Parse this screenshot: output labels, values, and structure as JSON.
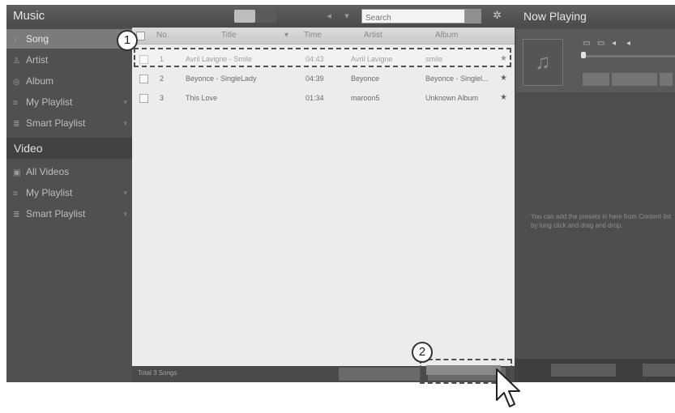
{
  "app": {
    "music_title": "Music",
    "search_placeholder": "Search",
    "icons": {
      "list_view": "list-view-icon",
      "grid_view": "grid-view-icon",
      "back": "back-arrow-icon",
      "forward": "forward-arrow-icon",
      "search": "search-icon",
      "settings": "gear-icon"
    }
  },
  "sidebar": {
    "music_items": [
      {
        "label": "Song",
        "icon": "note-icon",
        "selected": true
      },
      {
        "label": "Artist",
        "icon": "artist-icon"
      },
      {
        "label": "Album",
        "icon": "album-icon"
      },
      {
        "label": "My Playlist",
        "icon": "playlist-icon"
      },
      {
        "label": "Smart Playlist",
        "icon": "smart-playlist-icon"
      }
    ],
    "video_heading": "Video",
    "video_items": [
      {
        "label": "All Videos",
        "icon": "video-icon"
      },
      {
        "label": "My Playlist",
        "icon": "playlist-icon"
      },
      {
        "label": "Smart Playlist",
        "icon": "smart-playlist-icon"
      }
    ]
  },
  "table": {
    "columns": [
      "No.",
      "Title",
      "Time",
      "Artist",
      "Album"
    ],
    "rows": [
      {
        "no": "1",
        "title": "Avril Lavigne - Smile",
        "time": "04:43",
        "artist": "Avril Lavigne",
        "album": "smile"
      },
      {
        "no": "2",
        "title": "Beyonce - SingleLady",
        "time": "04:39",
        "artist": "Beyonce",
        "album": "Beyonce - Singlel..."
      },
      {
        "no": "3",
        "title": "This Love",
        "time": "01:34",
        "artist": "maroon5",
        "album": "Unknown Album"
      }
    ],
    "status_text": "Total 3 Songs"
  },
  "now_playing": {
    "title": "Now Playing",
    "hint": "You can add the presets in here from Content list by long click and drag and drop."
  },
  "annotations": {
    "callout_1": "1",
    "callout_2": "2"
  }
}
